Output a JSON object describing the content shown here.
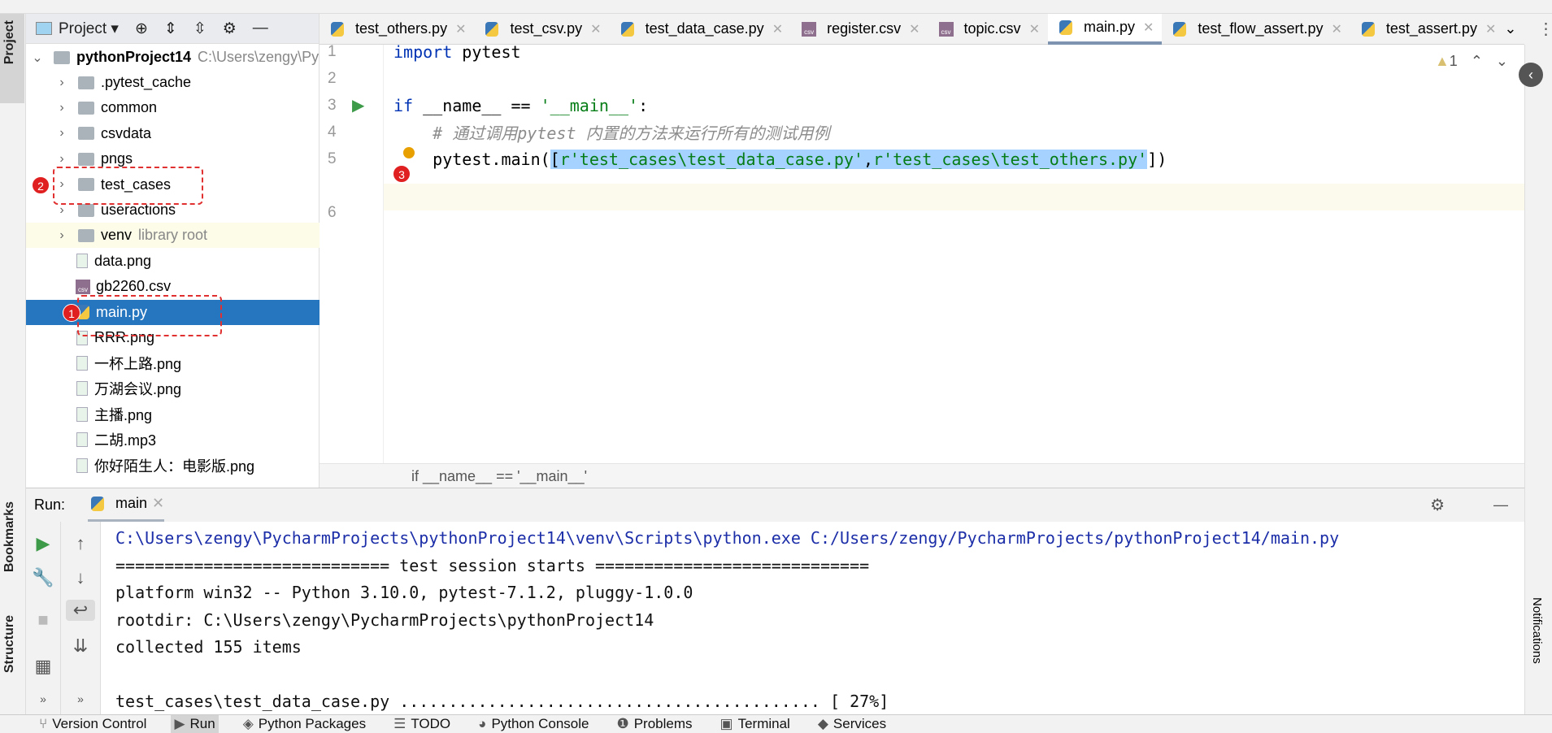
{
  "sidebar_left": {
    "project_label": "Project",
    "bookmarks_label": "Bookmarks",
    "structure_label": "Structure"
  },
  "project_panel": {
    "title": "Project",
    "root": {
      "name": "pythonProject14",
      "path": "C:\\Users\\zengy\\Py"
    },
    "items": [
      {
        "name": ".pytest_cache",
        "type": "folder"
      },
      {
        "name": "common",
        "type": "package"
      },
      {
        "name": "csvdata",
        "type": "folder"
      },
      {
        "name": "pngs",
        "type": "folder"
      },
      {
        "name": "test_cases",
        "type": "package"
      },
      {
        "name": "useractions",
        "type": "package"
      },
      {
        "name": "venv",
        "type": "folder",
        "note": "library root"
      },
      {
        "name": "data.png",
        "type": "image"
      },
      {
        "name": "gb2260.csv",
        "type": "csv"
      },
      {
        "name": "main.py",
        "type": "python",
        "selected": true
      },
      {
        "name": "RRR.png",
        "type": "image"
      },
      {
        "name": "一杯上路.png",
        "type": "image"
      },
      {
        "name": "万湖会议.png",
        "type": "image"
      },
      {
        "name": "主播.png",
        "type": "image"
      },
      {
        "name": "二胡.mp3",
        "type": "unknown"
      },
      {
        "name": "你好陌生人：电影版.png",
        "type": "image"
      }
    ]
  },
  "tabs": [
    {
      "label": "test_others.py",
      "icon": "python-file-icon"
    },
    {
      "label": "test_csv.py",
      "icon": "python-file-icon"
    },
    {
      "label": "test_data_case.py",
      "icon": "python-file-icon"
    },
    {
      "label": "register.csv",
      "icon": "csv-file-icon"
    },
    {
      "label": "topic.csv",
      "icon": "csv-file-icon"
    },
    {
      "label": "main.py",
      "icon": "python-file-icon",
      "active": true
    },
    {
      "label": "test_flow_assert.py",
      "icon": "python-file-icon"
    },
    {
      "label": "test_assert.py",
      "icon": "python-file-icon"
    }
  ],
  "editor": {
    "warning_count": "1",
    "lines": {
      "l1_kw": "import",
      "l1_rest": " pytest",
      "l3_kw": "if",
      "l3_mid": " __name__ == ",
      "l3_str": "'__main__'",
      "l3_end": ":",
      "l4": "    # 通过调用pytest 内置的方法来运行所有的测试用例",
      "l5_pre": "    pytest.main(",
      "l5_sel_a": "[",
      "l5_str1": "r'test_cases\\test_data_case.py'",
      "l5_comma": ",",
      "l5_str2": "r'test_cases\\test_others.py'",
      "l5_sel_b": "]",
      "l5_end": ")"
    },
    "line_numbers": [
      "1",
      "2",
      "3",
      "4",
      "5",
      "6"
    ],
    "breadcrumb": "if __name__ == '__main__'"
  },
  "annotations": [
    "1",
    "2",
    "3"
  ],
  "run": {
    "label": "Run:",
    "tab": "main",
    "output": [
      "C:\\Users\\zengy\\PycharmProjects\\pythonProject14\\venv\\Scripts\\python.exe C:/Users/zengy/PycharmProjects/pythonProject14/main.py",
      "============================ test session starts ============================",
      "platform win32 -- Python 3.10.0, pytest-7.1.2, pluggy-1.0.0",
      "rootdir: C:\\Users\\zengy\\PycharmProjects\\pythonProject14",
      "collected 155 items",
      "",
      "test_cases\\test_data_case.py ........................................... [ 27%]"
    ]
  },
  "statusbar": [
    "Version Control",
    "Run",
    "Python Packages",
    "TODO",
    "Python Console",
    "Problems",
    "Terminal",
    "Services"
  ],
  "right_strip": {
    "notifications_label": "Notifications"
  },
  "colors": {
    "selection": "#2675bf",
    "annotation": "#e02020",
    "keyword": "#0033b3",
    "string": "#067d17"
  }
}
